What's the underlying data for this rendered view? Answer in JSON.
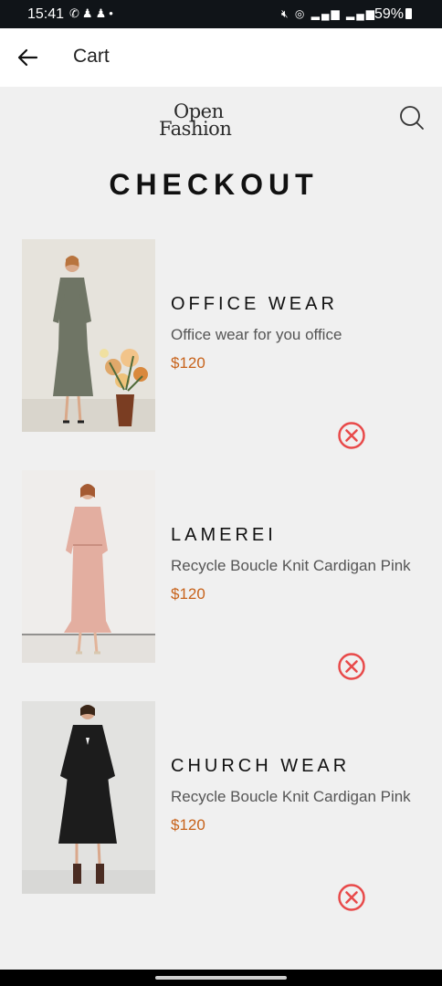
{
  "status_bar": {
    "time": "15:41",
    "left_icons": [
      "whatsapp-icon",
      "snapchat-icon",
      "snapchat-icon",
      "dot-icon"
    ],
    "right_icons": [
      "mute-icon",
      "hotspot-icon",
      "signal-icon",
      "signal-icon"
    ],
    "battery": "59%"
  },
  "appbar": {
    "title": "Cart"
  },
  "header": {
    "logo_line1": "Open",
    "logo_line2": "Fashion"
  },
  "page": {
    "heading": "CHECKOUT"
  },
  "cart": {
    "items": [
      {
        "name": "OFFICE WEAR",
        "description": "Office wear for you office",
        "price": "$120",
        "image": "woman-in-grey-suit-dress-photo"
      },
      {
        "name": "LAMEREI",
        "description": "Recycle Boucle Knit Cardigan Pink",
        "price": "$120",
        "image": "woman-in-pink-knit-dress-photo"
      },
      {
        "name": "CHURCH WEAR",
        "description": "Recycle Boucle Knit Cardigan Pink",
        "price": "$120",
        "image": "woman-in-black-dress-photo"
      }
    ]
  },
  "colors": {
    "accent_price": "#c7621a",
    "remove_icon": "#e84a4a",
    "background": "#f0f0f0"
  }
}
